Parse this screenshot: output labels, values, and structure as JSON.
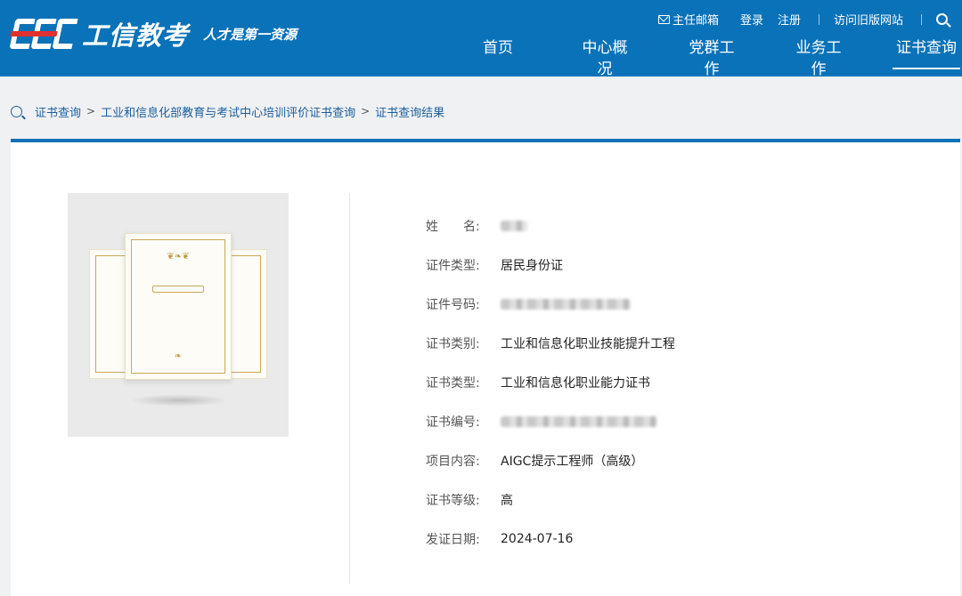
{
  "header": {
    "logo_text": "工信教考",
    "logo_mark": "CEC",
    "slogan": "人才是第一资源",
    "top_links": {
      "mail": "主任邮箱",
      "login": "登录",
      "register": "注册",
      "old_site": "访问旧版网站"
    },
    "nav": [
      "首页",
      "中心概况",
      "党群工作",
      "业务工作",
      "证书查询"
    ],
    "active_nav": "证书查询"
  },
  "breadcrumb": [
    "证书查询",
    "工业和信息化部教育与考试中心培训评价证书查询",
    "证书查询结果"
  ],
  "certificate": {
    "fields": [
      {
        "label": "姓　　名:",
        "value": "",
        "masked": true
      },
      {
        "label": "证件类型:",
        "value": "居民身份证",
        "masked": false
      },
      {
        "label": "证件号码:",
        "value": "",
        "masked": true
      },
      {
        "label": "证书类别:",
        "value": "工业和信息化职业技能提升工程",
        "masked": false
      },
      {
        "label": "证书类型:",
        "value": "工业和信息化职业能力证书",
        "masked": false
      },
      {
        "label": "证书编号:",
        "value": "",
        "masked": true
      },
      {
        "label": "项目内容:",
        "value": "AIGC提示工程师（高级）",
        "masked": false
      },
      {
        "label": "证书等级:",
        "value": "高",
        "masked": false
      },
      {
        "label": "发证日期:",
        "value": "2024-07-16",
        "masked": false
      }
    ]
  },
  "colors": {
    "brand_blue": "#0a72b8",
    "logo_red": "#e03030",
    "link_blue": "#1a5f9e"
  }
}
